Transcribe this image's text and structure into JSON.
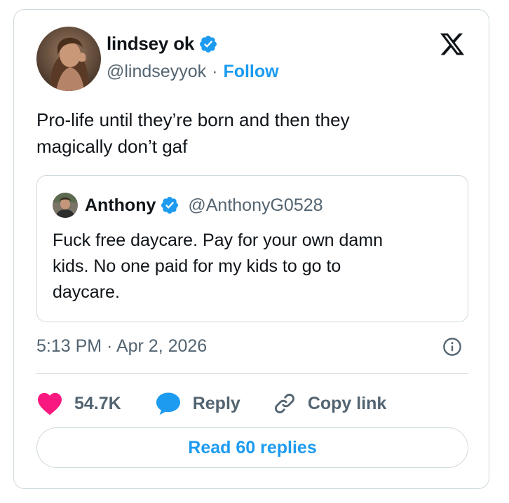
{
  "tweet": {
    "author": {
      "name": "lindsey ok",
      "handle": "@lindseyyok",
      "separator": "·",
      "follow_label": "Follow",
      "verified": true,
      "avatar_icon": "profile-photo"
    },
    "brand_icon": "x-logo-icon",
    "text": "Pro-life until they’re born and then they\nmagically don’t gaf",
    "quote": {
      "name": "Anthony",
      "handle": "@AnthonyG0528",
      "verified": true,
      "text": "Fuck free daycare. Pay for your own damn\nkids. No one paid for my kids to go to\ndaycare."
    },
    "timestamp": "5:13 PM · Apr 2, 2026",
    "actions": {
      "likes": "54.7K",
      "reply_label": "Reply",
      "copy_link_label": "Copy link"
    },
    "read_replies_label": "Read 60 replies"
  },
  "colors": {
    "accent": "#1d9bf0",
    "like": "#f91880",
    "muted_text": "#536471",
    "border": "#cfd9de",
    "text": "#0f1419"
  }
}
